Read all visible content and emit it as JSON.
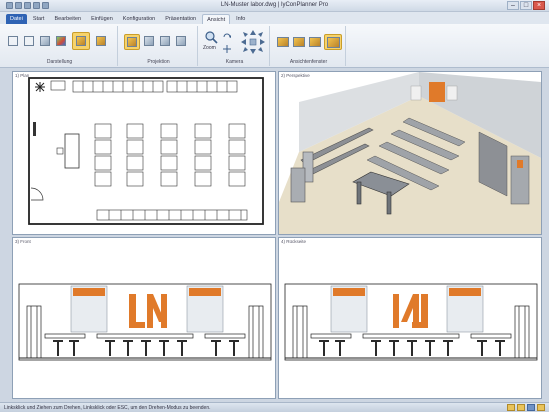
{
  "window": {
    "title": "LN-Muster labor.dwg | lyConPlanner Pro"
  },
  "tabs": [
    {
      "label": "Datei",
      "file": true
    },
    {
      "label": "Start"
    },
    {
      "label": "Bearbeiten"
    },
    {
      "label": "Einfügen"
    },
    {
      "label": "Konfiguration"
    },
    {
      "label": "Präsentation"
    },
    {
      "label": "Ansicht",
      "active": true
    },
    {
      "label": "Info"
    }
  ],
  "ribbon": {
    "groups": [
      {
        "label": "Darstellung"
      },
      {
        "label": "Projektion"
      },
      {
        "label": "Kamera"
      },
      {
        "label": "Ansichtenfenster"
      }
    ],
    "zoom_label": "Zoom"
  },
  "viewports": {
    "top_left": "1) Plan",
    "top_right": "2) Perspektive",
    "bottom_left": "3) Front",
    "bottom_right": "4) Rückseite"
  },
  "status": {
    "text": "Linksklick und Ziehen zum Drehen, Linksklick oder ESC, um den Drehen-Modus zu beenden."
  }
}
